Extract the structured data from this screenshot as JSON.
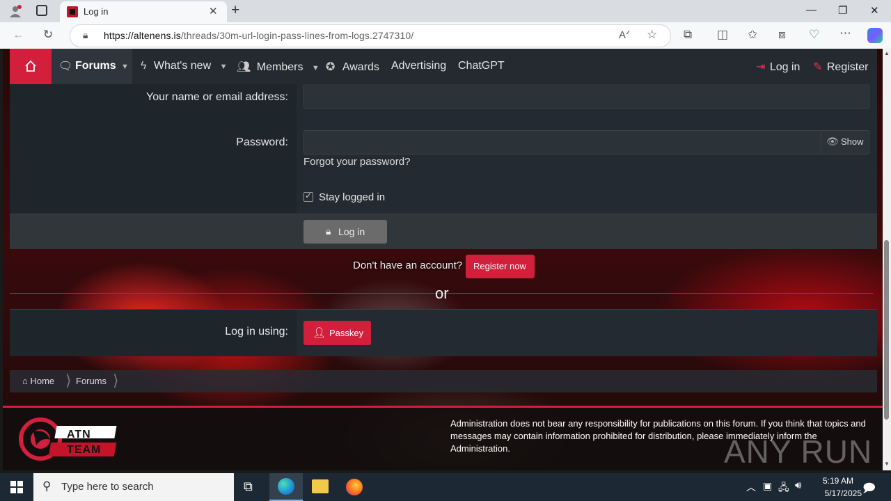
{
  "browser": {
    "tab_title": "Log in",
    "url_host": "https://altenens.is",
    "url_path": "/threads/30m-url-login-pass-lines-from-logs.2747310/"
  },
  "nav": {
    "items": [
      {
        "label": "Forums"
      },
      {
        "label": "What's new"
      },
      {
        "label": "Members"
      },
      {
        "label": "Awards"
      },
      {
        "label": "Advertising"
      },
      {
        "label": "ChatGPT"
      }
    ],
    "login_label": "Log in",
    "register_label": "Register"
  },
  "form": {
    "username_label": "Your name or email address:",
    "password_label": "Password:",
    "show_label": "Show",
    "forgot_link": "Forgot your password?",
    "stay_logged_in": "Stay logged in",
    "stay_logged_in_checked": true,
    "submit_label": "Log in"
  },
  "register": {
    "prompt": "Don't have an account?",
    "button": "Register now"
  },
  "or_text": "or",
  "passkey": {
    "label": "Log in using:",
    "button": "Passkey"
  },
  "breadcrumb": [
    "Home",
    "Forums"
  ],
  "footer": {
    "logo_text": "ATN TEAM",
    "disclaimer": "Administration does not bear any responsibility for publications on this forum. If you think that topics and messages may contain information prohibited for distribution, please immediately inform the Administration."
  },
  "watermark": "ANY RUN",
  "taskbar": {
    "search_placeholder": "Type here to search",
    "time": "5:19 AM",
    "date": "5/17/2025"
  },
  "colors": {
    "accent": "#d21f3c",
    "nav_bg": "#242a30"
  }
}
